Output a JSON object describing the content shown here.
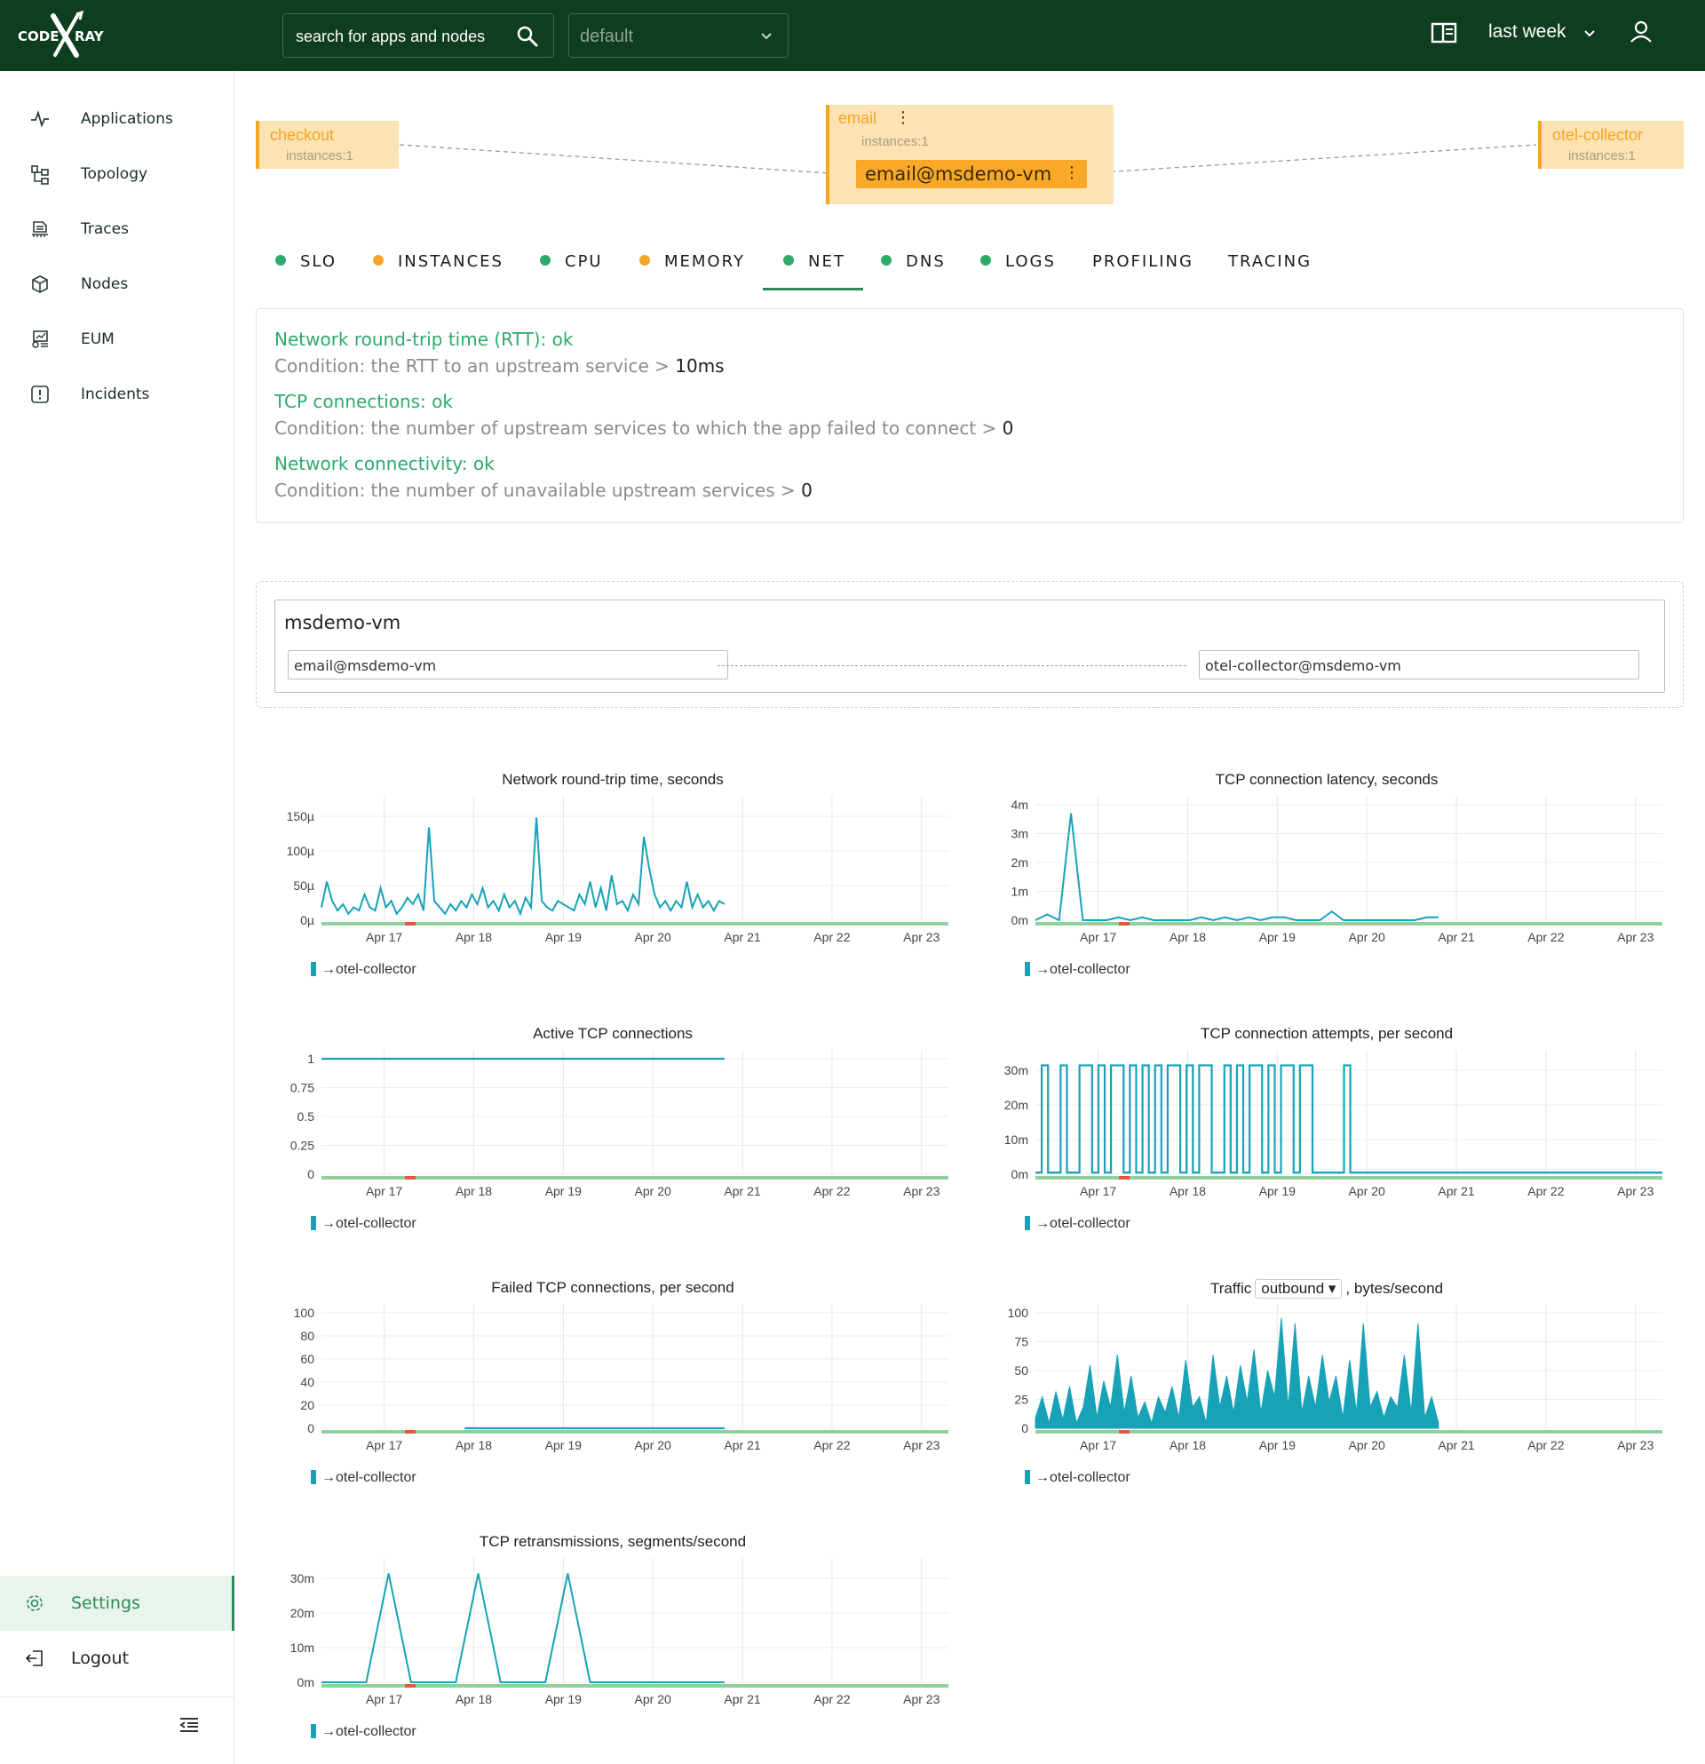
{
  "header": {
    "logo_left": "CODE",
    "logo_right": "RAY",
    "search_placeholder": "search for apps and nodes",
    "project": "default",
    "time_range": "last week"
  },
  "sidebar": {
    "items": [
      {
        "label": "Applications",
        "icon": "pulse-icon"
      },
      {
        "label": "Topology",
        "icon": "topology-icon"
      },
      {
        "label": "Traces",
        "icon": "traces-icon"
      },
      {
        "label": "Nodes",
        "icon": "cube-icon"
      },
      {
        "label": "EUM",
        "icon": "eum-icon"
      },
      {
        "label": "Incidents",
        "icon": "alert-icon"
      }
    ],
    "settings": "Settings",
    "logout": "Logout"
  },
  "map": {
    "left": {
      "name": "checkout",
      "instances": "instances:1"
    },
    "center": {
      "name": "email",
      "instances": "instances:1",
      "instance": "email@msdemo-vm"
    },
    "right": {
      "name": "otel-collector",
      "instances": "instances:1"
    }
  },
  "tabs": [
    {
      "label": "SLO",
      "status": "#2eaa6a"
    },
    {
      "label": "INSTANCES",
      "status": "#f5a623"
    },
    {
      "label": "CPU",
      "status": "#2eaa6a"
    },
    {
      "label": "MEMORY",
      "status": "#f5a623"
    },
    {
      "label": "NET",
      "status": "#2eaa6a",
      "active": true
    },
    {
      "label": "DNS",
      "status": "#2eaa6a"
    },
    {
      "label": "LOGS",
      "status": "#2eaa6a"
    },
    {
      "label": "PROFILING",
      "status": null
    },
    {
      "label": "TRACING",
      "status": null
    }
  ],
  "checks": [
    {
      "title": "Network round-trip time (RTT): ok",
      "condition": "Condition: the RTT to an upstream service > ",
      "threshold": "10ms"
    },
    {
      "title": "TCP connections: ok",
      "condition": "Condition: the number of upstream services to which the app failed to connect > ",
      "threshold": "0"
    },
    {
      "title": "Network connectivity: ok",
      "condition": "Condition: the number of unavailable upstream services > ",
      "threshold": "0"
    }
  ],
  "node": {
    "name": "msdemo-vm",
    "instance_left": "email@msdemo-vm",
    "instance_right": "otel-collector@msdemo-vm"
  },
  "colors": {
    "series": "#17a2b8",
    "ok": "#2eaa6a",
    "warning": "#f5a623",
    "header_bg": "#0f3d1f"
  },
  "chart_data": [
    {
      "type": "line",
      "title": "Network round-trip time, seconds",
      "x": [
        "Apr 17",
        "Apr 18",
        "Apr 19",
        "Apr 20",
        "Apr 21",
        "Apr 22",
        "Apr 23"
      ],
      "yticks": [
        "0µ",
        "50µ",
        "100µ",
        "150µ"
      ],
      "ylim": [
        0,
        180
      ],
      "series": [
        {
          "name": "→otel-collector",
          "values": [
            20,
            60,
            30,
            15,
            25,
            10,
            20,
            15,
            40,
            20,
            15,
            50,
            20,
            30,
            10,
            20,
            35,
            25,
            40,
            15,
            145,
            30,
            20,
            10,
            25,
            15,
            30,
            20,
            40,
            25,
            50,
            20,
            30,
            15,
            40,
            20,
            30,
            10,
            35,
            20,
            160,
            30,
            20,
            15,
            30,
            25,
            20,
            15,
            40,
            25,
            60,
            20,
            50,
            15,
            70,
            25,
            30,
            15,
            40,
            25,
            130,
            80,
            40,
            20,
            30,
            15,
            30,
            20,
            60,
            20,
            40,
            20,
            30,
            15,
            30,
            25
          ]
        }
      ]
    },
    {
      "type": "line",
      "title": "TCP connection latency, seconds",
      "x": [
        "Apr 17",
        "Apr 18",
        "Apr 19",
        "Apr 20",
        "Apr 21",
        "Apr 22",
        "Apr 23"
      ],
      "yticks": [
        "0m",
        "1m",
        "2m",
        "3m",
        "4m"
      ],
      "ylim": [
        0,
        4
      ],
      "series": [
        {
          "name": "→otel-collector",
          "values": [
            0,
            0.2,
            0,
            3.7,
            0,
            0,
            0,
            0.1,
            0,
            0.1,
            0,
            0,
            0,
            0,
            0.1,
            0,
            0.1,
            0,
            0.1,
            0,
            0.1,
            0.1,
            0,
            0,
            0,
            0.3,
            0,
            0,
            0,
            0,
            0,
            0,
            0,
            0.1,
            0.1
          ]
        }
      ]
    },
    {
      "type": "line",
      "title": "Active TCP connections",
      "x": [
        "Apr 17",
        "Apr 18",
        "Apr 19",
        "Apr 20",
        "Apr 21",
        "Apr 22",
        "Apr 23"
      ],
      "yticks": [
        "0",
        "0.25",
        "0.5",
        "0.75",
        "1"
      ],
      "ylim": [
        0,
        1
      ],
      "series": [
        {
          "name": "→otel-collector",
          "values": [
            1,
            1
          ]
        }
      ]
    },
    {
      "type": "line",
      "title": "TCP connection attempts, per second",
      "x": [
        "Apr 17",
        "Apr 18",
        "Apr 19",
        "Apr 20",
        "Apr 21",
        "Apr 22",
        "Apr 23"
      ],
      "yticks": [
        "0m",
        "10m",
        "20m",
        "30m"
      ],
      "ylim": [
        0,
        35
      ],
      "series": [
        {
          "name": "→otel-collector",
          "pattern": [
            0,
            1,
            0,
            0,
            1,
            0,
            0,
            1,
            1,
            0,
            1,
            0,
            1,
            1,
            0,
            1,
            0,
            1,
            0,
            1,
            0,
            1,
            1,
            0,
            1,
            0,
            1,
            1,
            0,
            0,
            1,
            0,
            1,
            0,
            1,
            1,
            0,
            1,
            0,
            1,
            1,
            0,
            1,
            1,
            0,
            0,
            0,
            0,
            0,
            1,
            0,
            0,
            0,
            0,
            0,
            0,
            0,
            0,
            0,
            0,
            0,
            0,
            0,
            0,
            0
          ],
          "peak": 33
        }
      ]
    },
    {
      "type": "line",
      "title": "Failed TCP connections, per second",
      "x": [
        "Apr 17",
        "Apr 18",
        "Apr 19",
        "Apr 20",
        "Apr 21",
        "Apr 22",
        "Apr 23"
      ],
      "yticks": [
        "0",
        "20",
        "40",
        "60",
        "80",
        "100"
      ],
      "ylim": [
        0,
        100
      ],
      "series": [
        {
          "name": "→otel-collector",
          "values": [
            0,
            0
          ]
        }
      ]
    },
    {
      "type": "area",
      "title": "Traffic",
      "title_suffix": ", bytes/second",
      "select_value": "outbound",
      "x": [
        "Apr 17",
        "Apr 18",
        "Apr 19",
        "Apr 20",
        "Apr 21",
        "Apr 22",
        "Apr 23"
      ],
      "yticks": [
        "0",
        "25",
        "50",
        "75",
        "100"
      ],
      "ylim": [
        0,
        110
      ],
      "series": [
        {
          "name": "→otel-collector",
          "values": [
            10,
            30,
            5,
            35,
            8,
            40,
            5,
            20,
            60,
            10,
            45,
            20,
            70,
            15,
            50,
            10,
            25,
            5,
            30,
            15,
            40,
            10,
            65,
            20,
            30,
            5,
            70,
            20,
            50,
            15,
            60,
            25,
            75,
            15,
            55,
            30,
            105,
            20,
            100,
            15,
            50,
            20,
            70,
            25,
            50,
            10,
            65,
            15,
            100,
            20,
            35,
            10,
            30,
            20,
            70,
            15,
            100,
            10,
            30,
            5
          ]
        }
      ]
    },
    {
      "type": "line",
      "title": "TCP retransmissions, segments/second",
      "x": [
        "Apr 17",
        "Apr 18",
        "Apr 19",
        "Apr 20",
        "Apr 21",
        "Apr 22",
        "Apr 23"
      ],
      "yticks": [
        "0m",
        "10m",
        "20m",
        "30m"
      ],
      "ylim": [
        0,
        35
      ],
      "series": [
        {
          "name": "→otel-collector",
          "values": [
            0,
            0,
            0,
            33,
            0,
            0,
            0,
            33,
            0,
            0,
            0,
            33,
            0,
            0,
            0,
            0,
            0,
            0,
            0
          ]
        }
      ]
    }
  ]
}
